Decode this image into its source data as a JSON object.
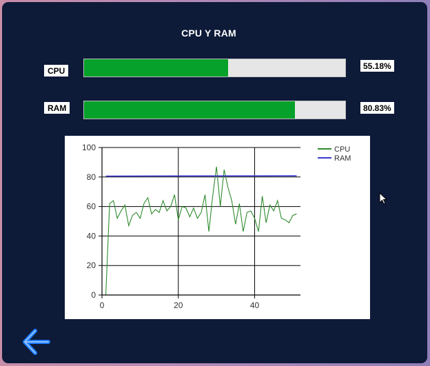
{
  "title": "CPU Y RAM",
  "meters": [
    {
      "label": "CPU",
      "percent_text": "55.18%",
      "value": 55.18
    },
    {
      "label": "RAM",
      "percent_text": "80.83%",
      "value": 80.83
    }
  ],
  "colors": {
    "bar_fill": "#06a12a",
    "bar_track": "#e6e6e6",
    "cpu_line": "#2e8b2e",
    "ram_line": "#3a3acf",
    "window_bg": "#0d1a38",
    "back_icon": "#1e7bff"
  },
  "back_icon": "arrow-left-icon",
  "chart_data": {
    "type": "line",
    "x_range": [
      0,
      52
    ],
    "xlim": [
      0,
      52
    ],
    "ylim": [
      0,
      100
    ],
    "x_ticks": [
      "0",
      "20",
      "40"
    ],
    "y_ticks": [
      "0",
      "20",
      "40",
      "60",
      "80",
      "100"
    ],
    "grid": true,
    "legend_position": "top-right",
    "series": [
      {
        "name": "CPU",
        "color": "#2e8b2e",
        "x": [
          1,
          2,
          3,
          4,
          5,
          6,
          7,
          8,
          9,
          10,
          11,
          12,
          13,
          14,
          15,
          16,
          17,
          18,
          19,
          20,
          21,
          22,
          23,
          24,
          25,
          26,
          27,
          28,
          29,
          30,
          31,
          32,
          33,
          34,
          35,
          36,
          37,
          38,
          39,
          40,
          41,
          42,
          43,
          44,
          45,
          46,
          47,
          48,
          49,
          50,
          51
        ],
        "values": [
          0,
          62,
          64,
          52,
          57,
          61,
          47,
          54,
          56,
          52,
          62,
          66,
          55,
          58,
          56,
          64,
          57,
          60,
          68,
          51,
          60,
          59,
          53,
          59,
          52,
          56,
          68,
          43,
          67,
          87,
          60,
          85,
          73,
          64,
          48,
          62,
          43,
          56,
          57,
          52,
          43,
          67,
          49,
          61,
          57,
          64,
          52,
          51,
          49,
          54,
          55
        ]
      },
      {
        "name": "RAM",
        "color": "#3a3acf",
        "x": [
          1,
          51
        ],
        "values": [
          80.6,
          80.8
        ]
      }
    ]
  }
}
